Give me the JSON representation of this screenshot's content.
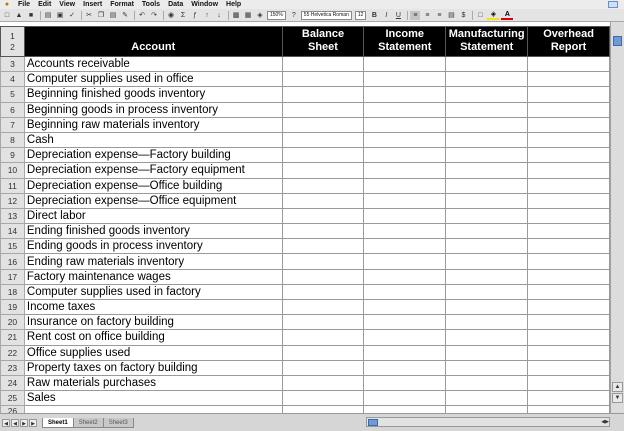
{
  "menubar": {
    "items": [
      "File",
      "Edit",
      "View",
      "Insert",
      "Format",
      "Tools",
      "Data",
      "Window",
      "Help"
    ]
  },
  "toolbar": {
    "zoom": "150%",
    "font_name": "55 Helvetica Roman",
    "font_size": "12",
    "bold": "B",
    "italic": "I",
    "underline": "U",
    "currency": "$",
    "font_color_glyph": "A"
  },
  "sheet": {
    "header_row_numbers": [
      "1",
      "2"
    ],
    "columns": [
      {
        "line1": "",
        "line2": "Account"
      },
      {
        "line1": "Balance",
        "line2": "Sheet"
      },
      {
        "line1": "Income",
        "line2": "Statement"
      },
      {
        "line1": "Manufacturing",
        "line2": "Statement"
      },
      {
        "line1": "Overhead",
        "line2": "Report"
      }
    ],
    "rows": [
      {
        "n": "3",
        "account": "Accounts receivable"
      },
      {
        "n": "4",
        "account": "Computer supplies used in office"
      },
      {
        "n": "5",
        "account": "Beginning finished goods inventory"
      },
      {
        "n": "6",
        "account": "Beginning goods in process inventory"
      },
      {
        "n": "7",
        "account": "Beginning raw materials inventory"
      },
      {
        "n": "8",
        "account": "Cash"
      },
      {
        "n": "9",
        "account": "Depreciation expense—Factory building"
      },
      {
        "n": "10",
        "account": "Depreciation expense—Factory equipment"
      },
      {
        "n": "11",
        "account": "Depreciation expense—Office building"
      },
      {
        "n": "12",
        "account": "Depreciation expense—Office equipment"
      },
      {
        "n": "13",
        "account": "Direct labor"
      },
      {
        "n": "14",
        "account": "Ending finished goods inventory"
      },
      {
        "n": "15",
        "account": "Ending goods in process inventory"
      },
      {
        "n": "16",
        "account": "Ending raw materials inventory"
      },
      {
        "n": "17",
        "account": "Factory maintenance wages"
      },
      {
        "n": "18",
        "account": "Computer supplies used in factory"
      },
      {
        "n": "19",
        "account": "Income taxes"
      },
      {
        "n": "20",
        "account": "Insurance on factory building"
      },
      {
        "n": "21",
        "account": "Rent cost on office building"
      },
      {
        "n": "22",
        "account": "Office supplies used"
      },
      {
        "n": "23",
        "account": "Property taxes on factory building"
      },
      {
        "n": "24",
        "account": "Raw materials purchases"
      },
      {
        "n": "25",
        "account": "Sales"
      },
      {
        "n": "26",
        "account": ""
      }
    ]
  },
  "tabs": [
    {
      "label": "Sheet1",
      "active": true
    },
    {
      "label": "Sheet2",
      "active": false
    },
    {
      "label": "Sheet3",
      "active": false
    }
  ],
  "colors": {
    "header_bg": "#000000",
    "header_text": "#ffffff",
    "scroll_thumb": "#6f9ad4"
  }
}
